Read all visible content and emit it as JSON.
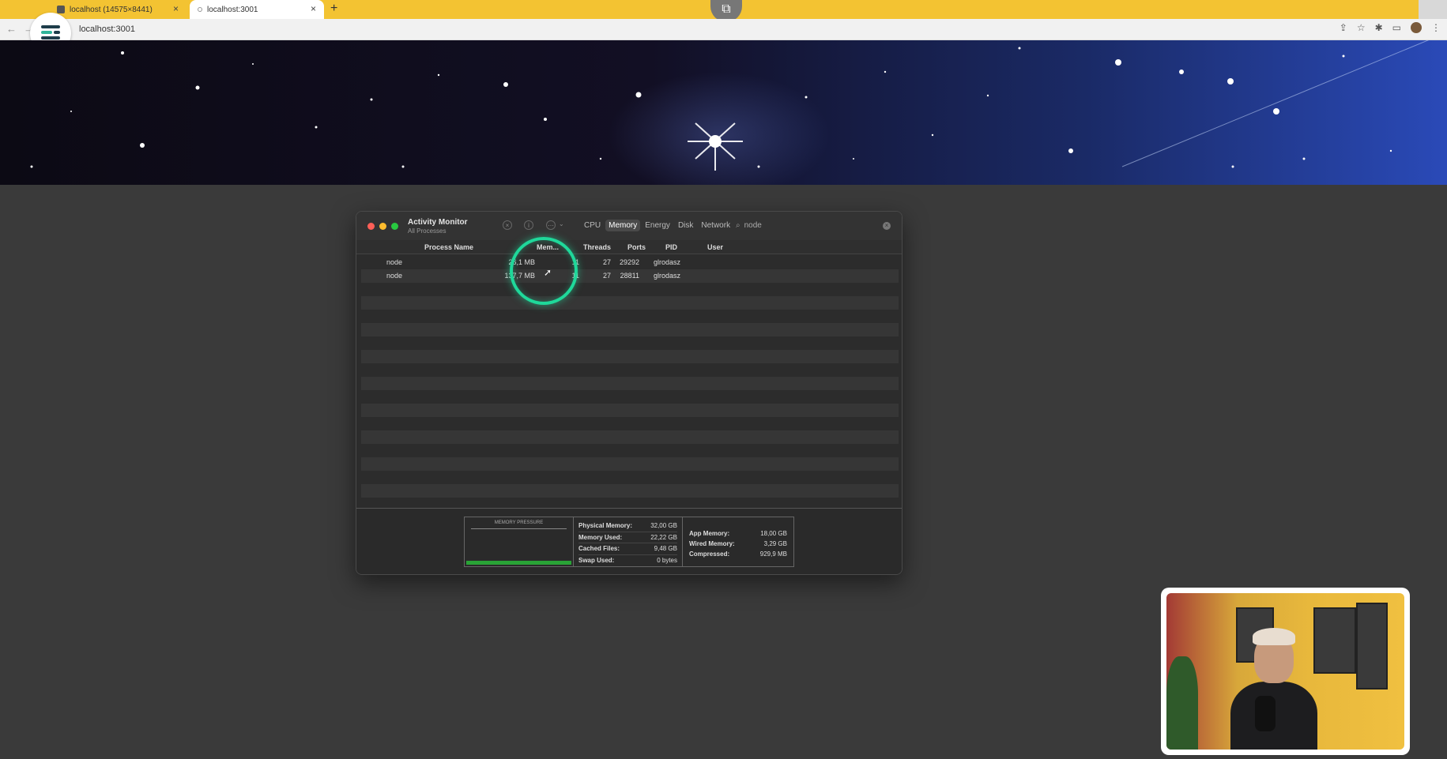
{
  "browser": {
    "tabs": [
      {
        "title": "localhost (14575×8441)"
      },
      {
        "title": "localhost:3001"
      }
    ],
    "new_tab": "+",
    "url": "localhost:3001",
    "icons": [
      "share-icon",
      "star-icon",
      "extensions-icon",
      "sidebar-icon",
      "avatar"
    ]
  },
  "activity_monitor": {
    "title": "Activity Monitor",
    "subtitle": "All Processes",
    "tabs": [
      "CPU",
      "Memory",
      "Energy",
      "Disk",
      "Network"
    ],
    "active_tab": "Memory",
    "search": {
      "value": "node"
    },
    "columns": [
      "Process Name",
      "Mem...",
      "Threads",
      "Ports",
      "PID",
      "User"
    ],
    "rows": [
      {
        "name": "node",
        "mem": "26,1 MB",
        "threads": "11",
        "ports": "27",
        "pid": "29292",
        "user": "glrodasz"
      },
      {
        "name": "node",
        "mem": "137,7 MB",
        "threads": "11",
        "ports": "27",
        "pid": "28811",
        "user": "glrodasz"
      }
    ],
    "footer": {
      "pressure_label": "MEMORY PRESSURE",
      "stats_left": [
        {
          "label": "Physical Memory:",
          "value": "32,00 GB"
        },
        {
          "label": "Memory Used:",
          "value": "22,22 GB"
        },
        {
          "label": "Cached Files:",
          "value": "9,48 GB"
        },
        {
          "label": "Swap Used:",
          "value": "0 bytes"
        }
      ],
      "stats_right": [
        {
          "label": "App Memory:",
          "value": "18,00 GB"
        },
        {
          "label": "Wired Memory:",
          "value": "3,29 GB"
        },
        {
          "label": "Compressed:",
          "value": "929,9 MB"
        }
      ]
    }
  },
  "colors": {
    "tabbar": "#f3c332",
    "ring": "#1fd89a",
    "pressure_green": "#29a336",
    "traffic_red": "#ff5f57",
    "traffic_yellow": "#febc2e",
    "traffic_green": "#28c840"
  }
}
